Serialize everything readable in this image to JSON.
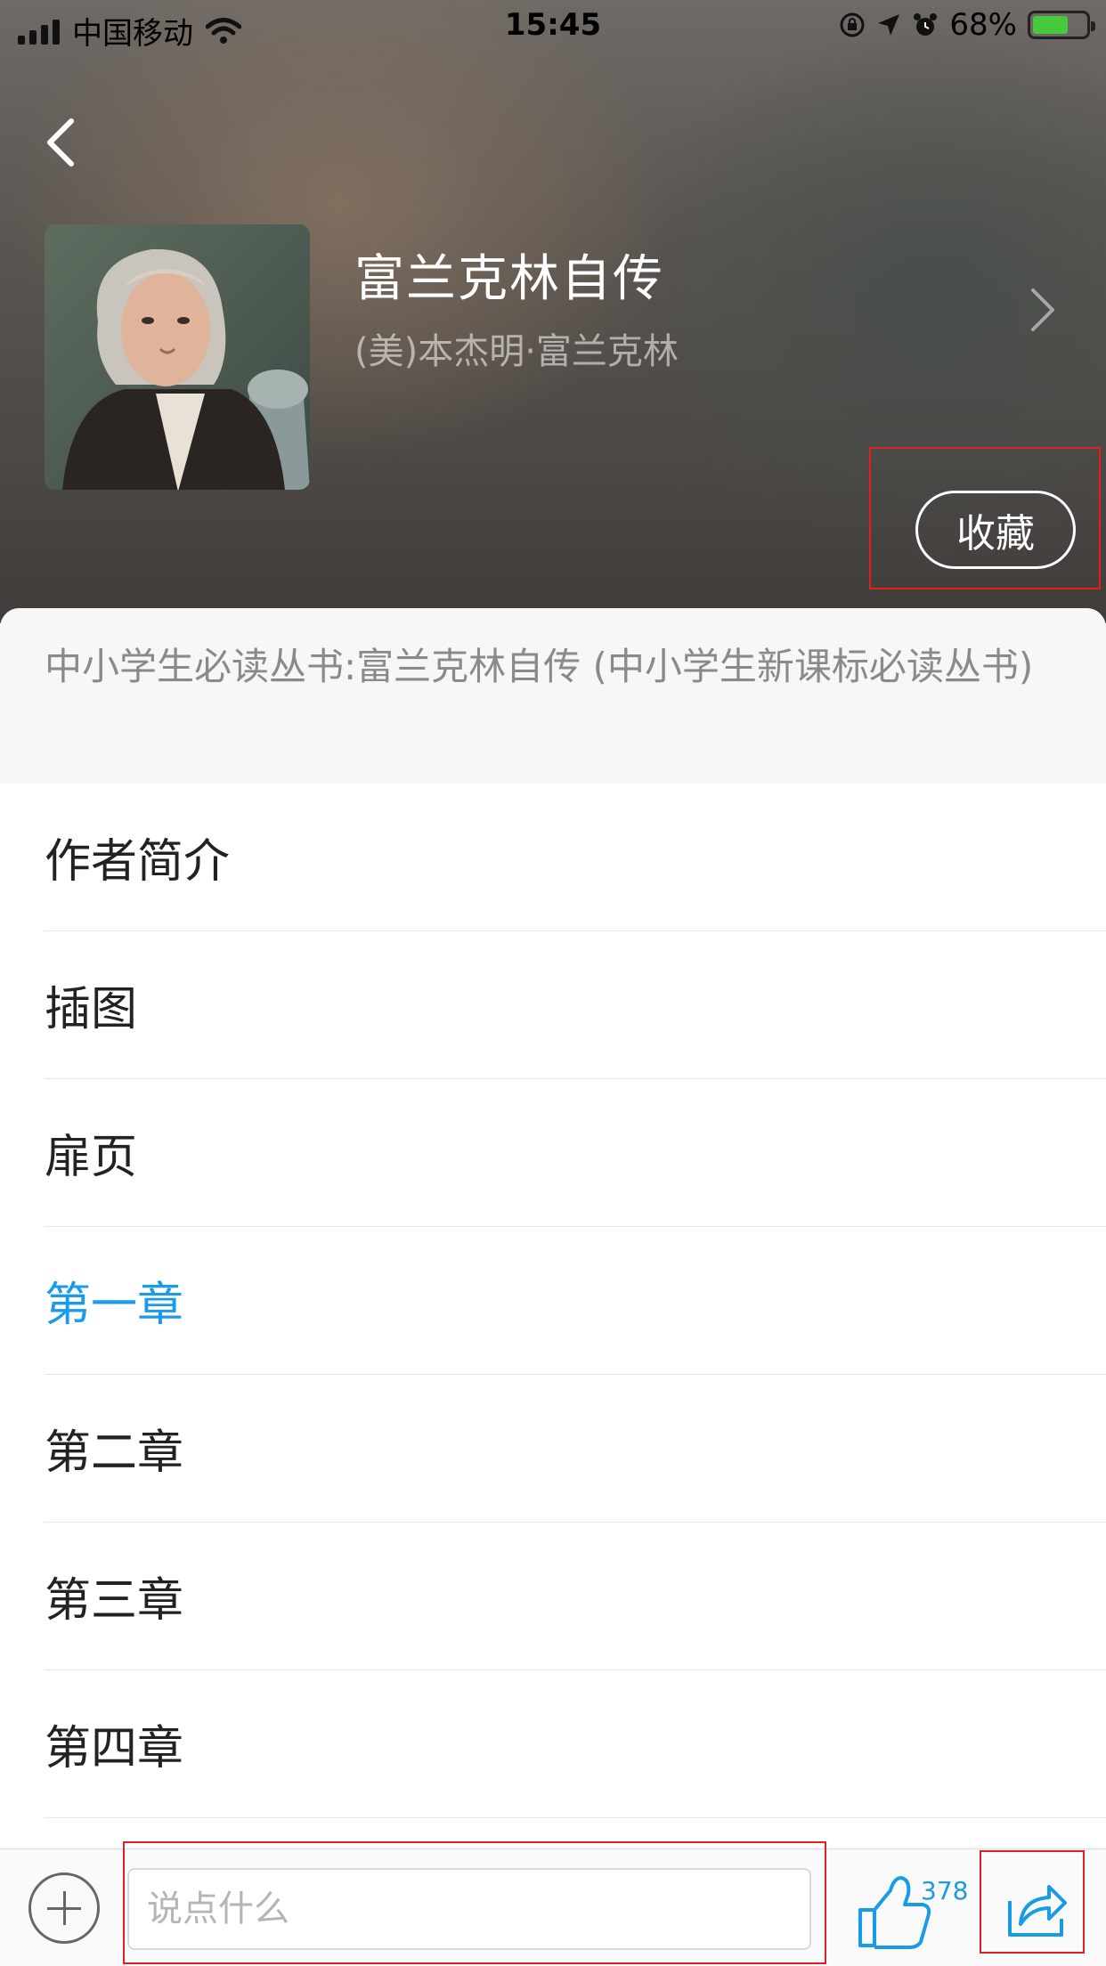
{
  "status_bar": {
    "carrier": "中国移动",
    "time": "15:45",
    "battery": "68%"
  },
  "book": {
    "title": "富兰克林自传",
    "author": "(美)本杰明·富兰克林",
    "favorite_label": "收藏",
    "series_title": "中小学生必读丛书:富兰克林自传 (中小学生新课标必读丛书)"
  },
  "toc": {
    "items": [
      {
        "label": "作者简介"
      },
      {
        "label": "插图"
      },
      {
        "label": "扉页"
      },
      {
        "label": "第一章"
      },
      {
        "label": "第二章"
      },
      {
        "label": "第三章"
      },
      {
        "label": "第四章"
      }
    ],
    "active_index": 3
  },
  "bottom_bar": {
    "comment_placeholder": "说点什么",
    "like_count": "378"
  },
  "colors": {
    "accent": "#1a9be8",
    "highlight": "#e02020",
    "battery": "#46c93a"
  },
  "icons": {
    "back": "chevron-left-icon",
    "detail": "chevron-right-icon",
    "add": "plus-circle-icon",
    "like": "thumbs-up-icon",
    "share": "share-icon"
  }
}
